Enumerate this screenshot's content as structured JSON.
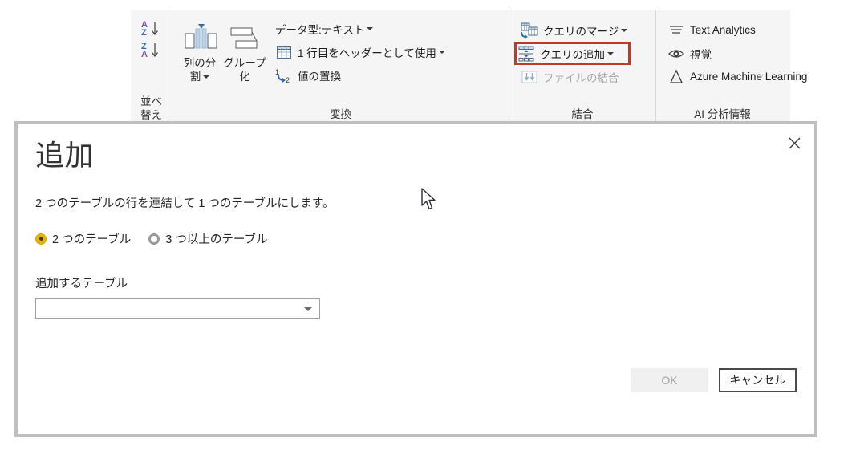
{
  "ribbon": {
    "groups": [
      {
        "name": "sort",
        "label": "並べ\n替え",
        "label_line1": "並べ",
        "label_line2": "替え",
        "items": [
          {
            "label": "",
            "icon": "sort-ascending-icon"
          },
          {
            "label": "",
            "icon": "sort-descending-icon"
          }
        ]
      },
      {
        "name": "transform",
        "label": "変換",
        "big_buttons": [
          {
            "label_line1": "列の分",
            "label_line2": "割",
            "icon": "split-column-icon",
            "has_caret": true
          },
          {
            "label_line1": "グループ",
            "label_line2": "化",
            "icon": "group-by-icon",
            "has_caret": false
          }
        ],
        "items": [
          {
            "label": "データ型:テキスト",
            "icon": "none",
            "has_caret": true,
            "disabled": false
          },
          {
            "label": "1 行目をヘッダーとして使用",
            "icon": "use-first-row-as-header-icon",
            "has_caret": true,
            "disabled": false
          },
          {
            "label": "値の置換",
            "icon": "replace-values-icon",
            "has_caret": false,
            "disabled": false
          }
        ]
      },
      {
        "name": "combine",
        "label": "結合",
        "items": [
          {
            "label": "クエリのマージ",
            "icon": "merge-queries-icon",
            "has_caret": true,
            "disabled": false,
            "highlighted": false
          },
          {
            "label": "クエリの追加",
            "icon": "append-queries-icon",
            "has_caret": true,
            "disabled": false,
            "highlighted": true
          },
          {
            "label": "ファイルの結合",
            "icon": "combine-files-icon",
            "has_caret": false,
            "disabled": true,
            "highlighted": false
          }
        ]
      },
      {
        "name": "ai-insights",
        "label": "AI 分析情報",
        "items": [
          {
            "label": "Text Analytics",
            "icon": "text-analytics-icon",
            "has_caret": false,
            "disabled": false
          },
          {
            "label": "視覚",
            "icon": "vision-eye-icon",
            "has_caret": false,
            "disabled": false
          },
          {
            "label": "Azure Machine Learning",
            "icon": "azure-machine-learning-icon",
            "has_caret": false,
            "disabled": false
          }
        ]
      }
    ]
  },
  "dialog": {
    "title": "追加",
    "description": "2 つのテーブルの行を連結して 1 つのテーブルにします。",
    "radio_options": [
      {
        "label": "2 つのテーブル",
        "selected": true
      },
      {
        "label": "3 つ以上のテーブル",
        "selected": false
      }
    ],
    "field_label": "追加するテーブル",
    "dropdown": {
      "value": "",
      "placeholder": ""
    },
    "ok_label": "OK",
    "ok_enabled": false,
    "cancel_label": "キャンセル",
    "close_icon": "close-icon"
  },
  "colors": {
    "highlight_red": "#c0392b",
    "radio_accent": "#e8b211",
    "ribbon_bg": "#f5f5f5",
    "dialog_border": "#bfbfbf",
    "icon_blue": "#2f6fb0"
  }
}
